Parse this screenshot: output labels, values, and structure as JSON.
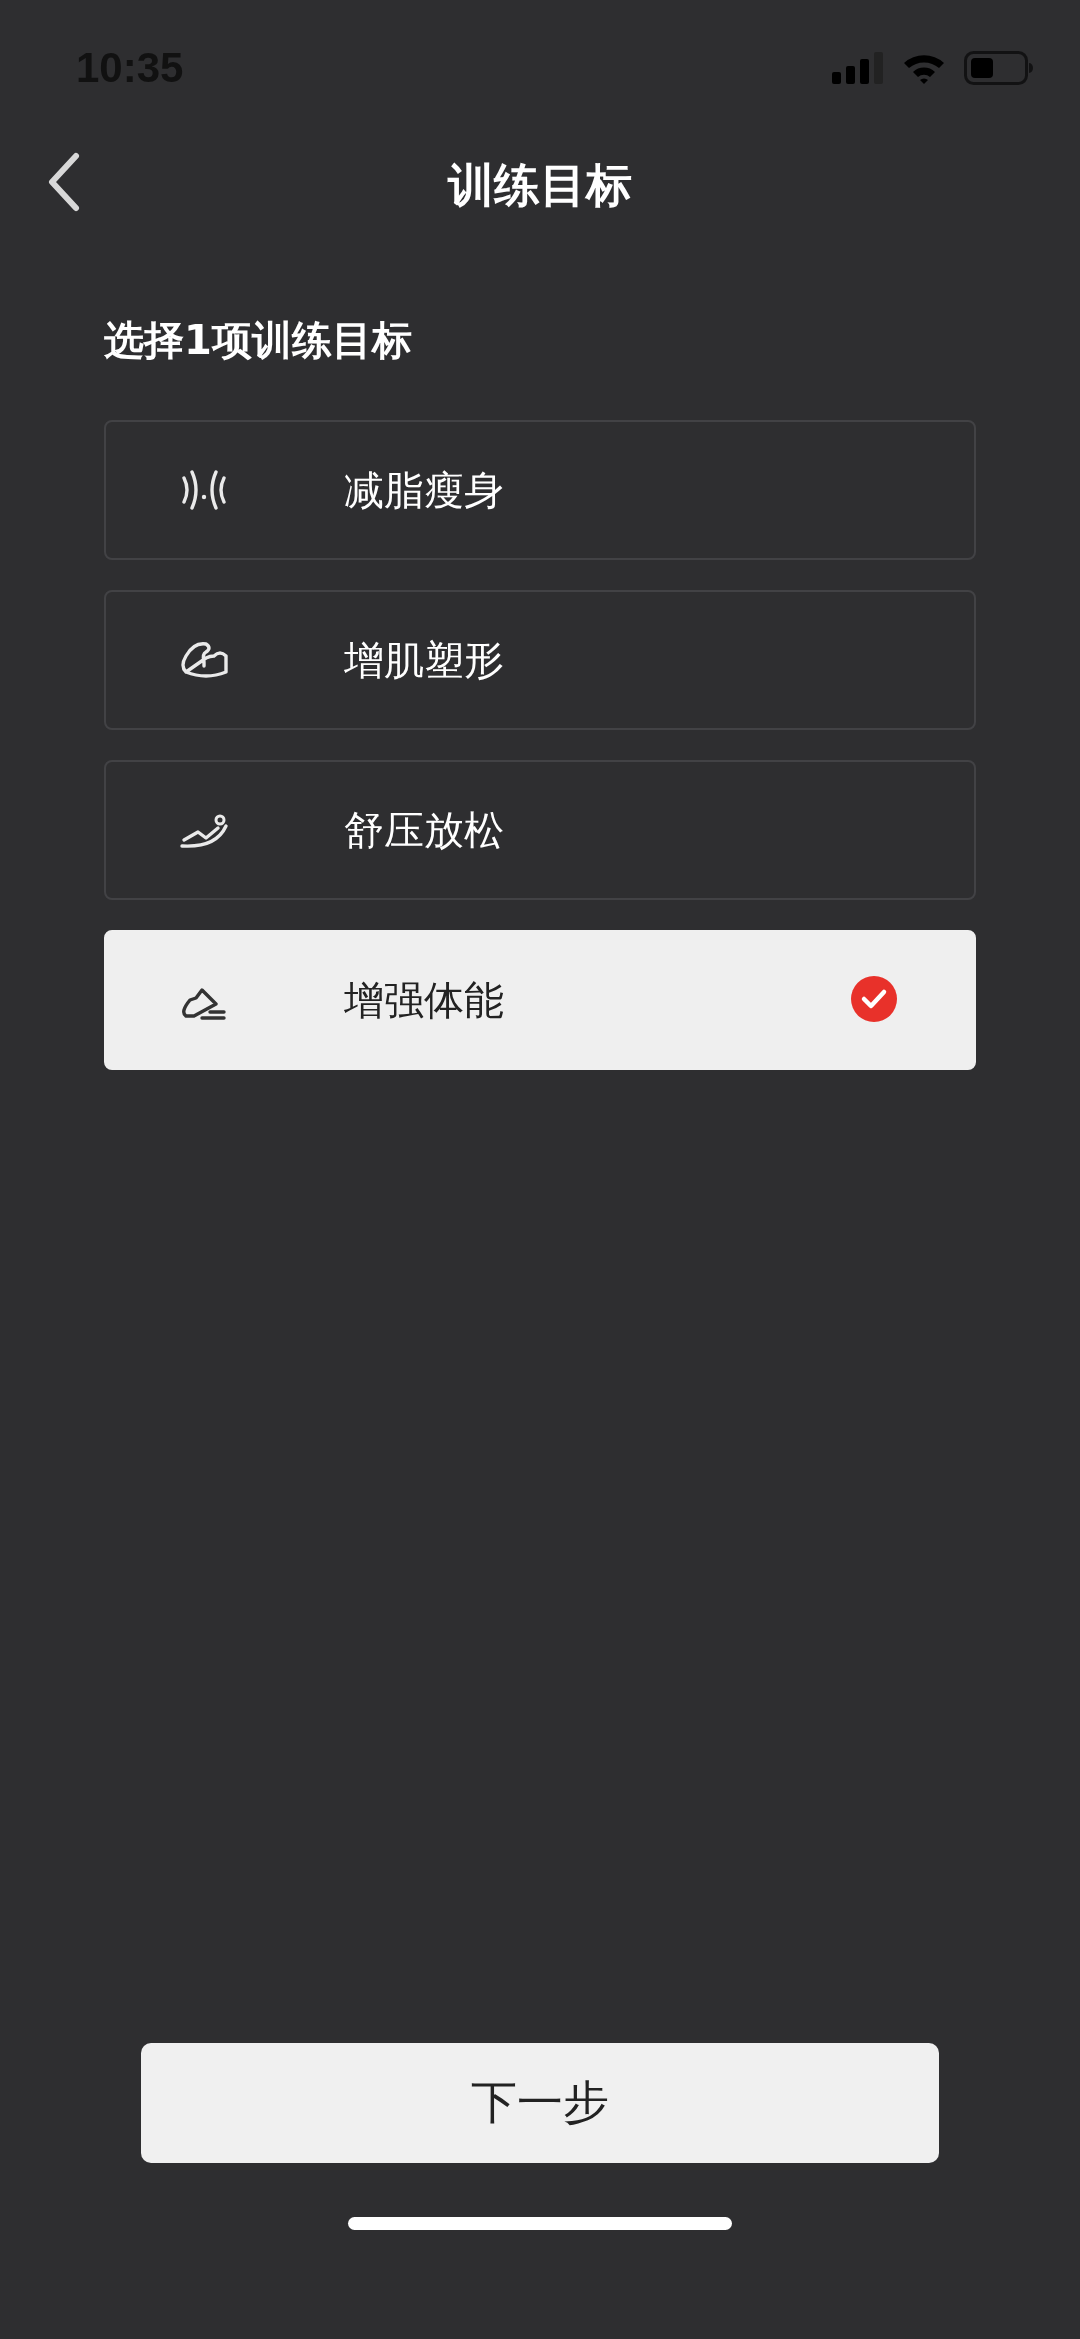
{
  "status_bar": {
    "time": "10:35"
  },
  "nav": {
    "title": "训练目标"
  },
  "prompt": "选择1项训练目标",
  "options": [
    {
      "kind": "waist",
      "label": "减脂瘦身",
      "selected": false
    },
    {
      "kind": "muscle",
      "label": "增肌塑形",
      "selected": false
    },
    {
      "kind": "relax",
      "label": "舒压放松",
      "selected": false
    },
    {
      "kind": "shoe",
      "label": "增强体能",
      "selected": true
    }
  ],
  "next_button": "下一步"
}
